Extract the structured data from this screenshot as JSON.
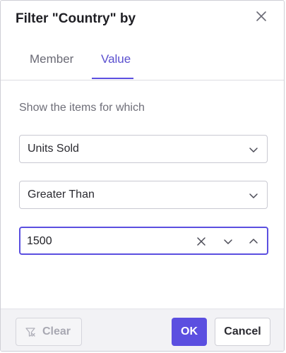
{
  "dialog": {
    "title": "Filter \"Country\" by",
    "close_icon": "close-icon"
  },
  "tabs": [
    {
      "label": "Member",
      "active": false
    },
    {
      "label": "Value",
      "active": true
    }
  ],
  "value_filter": {
    "prompt": "Show the items for which",
    "measure": "Units Sold",
    "condition": "Greater Than",
    "value": "1500",
    "icons": [
      "chevron-down-icon",
      "clear-icon",
      "chevron-up-icon"
    ]
  },
  "footer": {
    "clear_label": "Clear",
    "clear_icon": "filter-off-icon",
    "ok_label": "OK",
    "cancel_label": "Cancel"
  },
  "colors": {
    "accent": "#5b4fe0",
    "disabled_text": "#a8a8b2"
  }
}
